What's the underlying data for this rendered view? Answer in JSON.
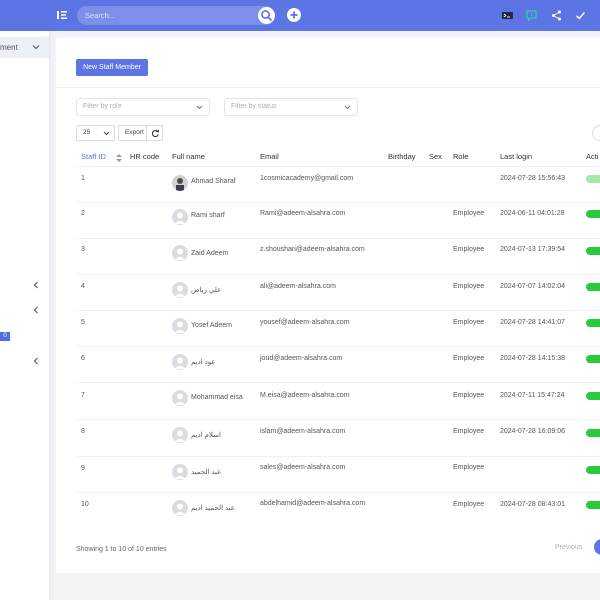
{
  "topbar": {
    "search_placeholder": "Search..."
  },
  "sidebar": {
    "active_item_label": "ment",
    "badge": "0"
  },
  "toolbar": {
    "new_staff_label": "New Staff Member",
    "filter_role_placeholder": "Filter by role",
    "filter_status_placeholder": "Filter by status",
    "page_length": "25",
    "export_label": "Export"
  },
  "table": {
    "headers": {
      "staff_id": "Staff ID",
      "hr_code": "HR code",
      "full_name": "Full name",
      "email": "Email",
      "birthday": "Birthday",
      "sex": "Sex",
      "role": "Role",
      "last_login": "Last login",
      "active": "Acti"
    },
    "rows": [
      {
        "id": "1",
        "name": "Ahmad Sharaf",
        "email": "1cosmicacademy@gmail.com",
        "role": "",
        "last_login": "2024-07-28 15:56:43",
        "active": "light"
      },
      {
        "id": "2",
        "name": "Rami sharf",
        "email": "Rami@adeem-alsahra.com",
        "role": "Employee",
        "last_login": "2024-06-11 04:01:28",
        "active": "on"
      },
      {
        "id": "3",
        "name": "Zaid Adeem",
        "email": "z.shoushari@adeem-alsahra.com",
        "role": "Employee",
        "last_login": "2024-07-13 17:39:54",
        "active": "on"
      },
      {
        "id": "4",
        "name": "علي رياض",
        "email": "ali@adeem-alsahra.com",
        "role": "Employee",
        "last_login": "2024-07-07 14:02:04",
        "active": "on"
      },
      {
        "id": "5",
        "name": "Yosef Adeem",
        "email": "yousef@adeem-alsahra.com",
        "role": "Employee",
        "last_login": "2024-07-28 14:41:07",
        "active": "on"
      },
      {
        "id": "6",
        "name": "عود ادیم",
        "email": "joud@adeem-alsahra.com",
        "role": "Employee",
        "last_login": "2024-07-28 14:15:38",
        "active": "on"
      },
      {
        "id": "7",
        "name": "Mohammad eisa",
        "email": "M.eisa@adeem-alsahra.com",
        "role": "Employee",
        "last_login": "2024-07-11 15:47:24",
        "active": "on"
      },
      {
        "id": "8",
        "name": "اسلام ادیم",
        "email": "islam@adeem-alsahra.com",
        "role": "Employee",
        "last_login": "2024-07-28 16:09:06",
        "active": "on"
      },
      {
        "id": "9",
        "name": "عبد الحمید",
        "email": "sales@adeem-alsahra.com",
        "role": "Employee",
        "last_login": "",
        "active": "on"
      },
      {
        "id": "10",
        "name": "عبد الحمید ادیم",
        "email": "abdelhamid@adeem-alsahra.com",
        "role": "Employee",
        "last_login": "2024-07-28 08:43:01",
        "active": "on"
      }
    ]
  },
  "footer": {
    "info": "Showing 1 to 10 of 10 entries",
    "previous_label": "Previous"
  },
  "colors": {
    "accent": "#5c74e4",
    "active_toggle": "#2bc93c"
  }
}
